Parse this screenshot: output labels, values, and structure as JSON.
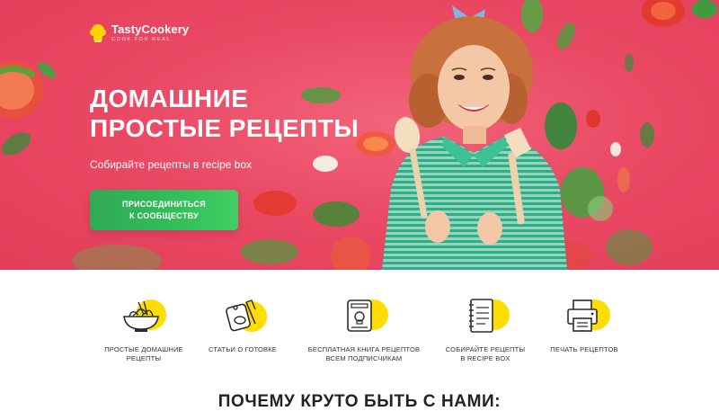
{
  "brand": {
    "name": "TastyCookery",
    "tagline": "COOK FOR REAL"
  },
  "hero": {
    "title_line1": "ДОМАШНИЕ",
    "title_line2": "ПРОСТЫЕ РЕЦЕПТЫ",
    "subtitle": "Собирайте рецепты в recipe box",
    "cta_label": "ПРИСОЕДИНИТЬСЯ\nК СООБЩЕСТВУ"
  },
  "features": [
    {
      "icon": "noodle-bowl-icon",
      "label": "ПРОСТЫЕ ДОМАШНИЕ\nРЕЦЕПТЫ"
    },
    {
      "icon": "cutting-board-icon",
      "label": "СТАТЬИ О ГОТОВКЕ"
    },
    {
      "icon": "recipe-book-icon",
      "label": "БЕСПЛАТНАЯ КНИГА РЕЦЕПТОВ\nВСЕМ ПОДПИСЧИКАМ"
    },
    {
      "icon": "notebook-icon",
      "label": "СОБИРАЙТЕ РЕЦЕПТЫ\nВ RECIPE BOX"
    },
    {
      "icon": "printer-icon",
      "label": "ПЕЧАТЬ РЕЦЕПТОВ"
    }
  ],
  "section": {
    "title": "ПОЧЕМУ КРУТО БЫТЬ С НАМИ:"
  },
  "colors": {
    "hero_background": "#ea4a65",
    "cta_green": "#33be5a",
    "icon_yellow": "#ffdd00",
    "icon_stroke": "#2b2b2b"
  }
}
